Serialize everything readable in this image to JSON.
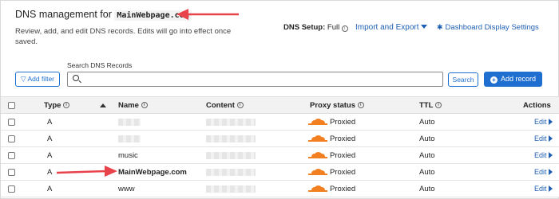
{
  "header": {
    "title_prefix": "DNS management for",
    "domain": "MainWebpage.com",
    "description": "Review, add, and edit DNS records. Edits will go into effect once saved.",
    "dns_setup_label": "DNS Setup:",
    "dns_setup_value": "Full",
    "import_export_label": "Import and Export",
    "dashboard_settings_label": "Dashboard Display Settings"
  },
  "toolbar": {
    "add_filter_label": "Add filter",
    "search_label": "Search DNS Records",
    "search_value": "",
    "search_button_label": "Search",
    "add_record_label": "Add record"
  },
  "table": {
    "columns": {
      "type": "Type",
      "name": "Name",
      "content": "Content",
      "proxy": "Proxy status",
      "ttl": "TTL",
      "actions": "Actions"
    },
    "rows": [
      {
        "type": "A",
        "name": "",
        "name_redacted": true,
        "proxy": "Proxied",
        "ttl": "Auto",
        "action": "Edit"
      },
      {
        "type": "A",
        "name": "",
        "name_redacted": true,
        "proxy": "Proxied",
        "ttl": "Auto",
        "action": "Edit"
      },
      {
        "type": "A",
        "name": "music",
        "name_redacted": false,
        "proxy": "Proxied",
        "ttl": "Auto",
        "action": "Edit"
      },
      {
        "type": "A",
        "name": "MainWebpage.com",
        "name_redacted": false,
        "proxy": "Proxied",
        "ttl": "Auto",
        "action": "Edit"
      },
      {
        "type": "A",
        "name": "www",
        "name_redacted": false,
        "proxy": "Proxied",
        "ttl": "Auto",
        "action": "Edit"
      }
    ]
  },
  "colors": {
    "accent_blue": "#1f6fd1",
    "link_blue": "#1f5fb3",
    "proxy_orange": "#f38020",
    "annotation_arrow": "#e8434a"
  },
  "icons": {
    "filter": "filter-icon",
    "search": "search-icon",
    "add": "plus-circle-icon",
    "info": "info-icon",
    "gear": "gear-icon",
    "cloud": "cloud-icon"
  }
}
